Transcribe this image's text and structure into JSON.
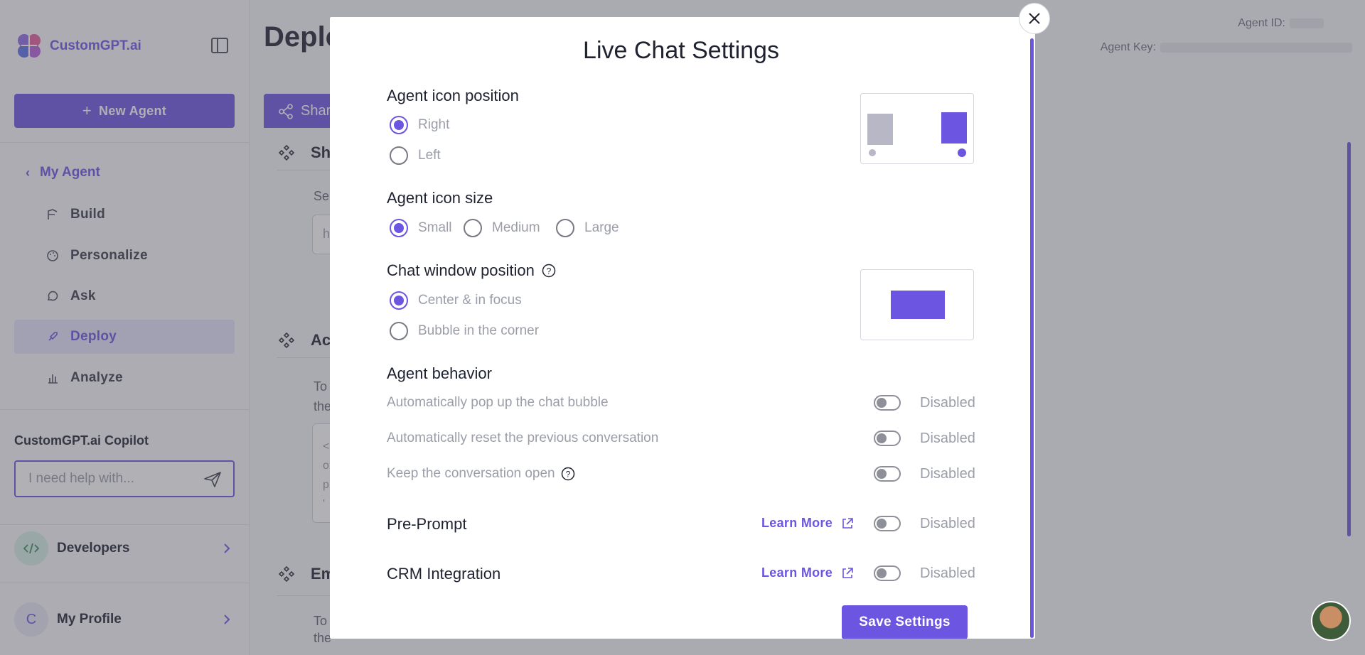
{
  "sidebar": {
    "logo_text": "CustomGPT.ai",
    "new_agent_label": "New Agent",
    "back_label": "My Agent",
    "nav": [
      {
        "label": "Build",
        "icon": "build-icon"
      },
      {
        "label": "Personalize",
        "icon": "palette-icon"
      },
      {
        "label": "Ask",
        "icon": "chat-icon"
      },
      {
        "label": "Deploy",
        "icon": "rocket-icon",
        "active": true
      },
      {
        "label": "Analyze",
        "icon": "bar-chart-icon"
      }
    ],
    "copilot": {
      "title": "CustomGPT.ai Copilot",
      "placeholder": "I need help with..."
    },
    "developers_label": "Developers",
    "profile_label": "My Profile",
    "profile_initial": "C"
  },
  "main": {
    "title": "Deplo",
    "tab_label": "Shar",
    "agent_id_label": "Agent ID:",
    "agent_key_label": "Agent Key:",
    "sections": [
      {
        "heading": "Sh",
        "text": [
          "Ser"
        ]
      },
      {
        "heading": "Ac",
        "text": [
          "To",
          "the"
        ]
      },
      {
        "heading": "Em",
        "text": [
          "To",
          "the "
        ]
      }
    ],
    "box1_text": "h",
    "box2_text": [
      "<",
      "o",
      "p",
      "'"
    ]
  },
  "modal": {
    "title": "Live Chat Settings",
    "icon_position": {
      "label": "Agent icon position",
      "options": [
        "Right",
        "Left"
      ],
      "selected": "Right"
    },
    "icon_size": {
      "label": "Agent icon size",
      "options": [
        "Small",
        "Medium",
        "Large"
      ],
      "selected": "Small"
    },
    "window_position": {
      "label": "Chat window position",
      "options": [
        "Center & in focus",
        "Bubble in the corner"
      ],
      "selected": "Center & in focus"
    },
    "behavior": {
      "label": "Agent behavior",
      "rows": [
        {
          "label": "Automatically pop up the chat bubble",
          "status": "Disabled",
          "help": false
        },
        {
          "label": "Automatically reset the previous conversation",
          "status": "Disabled",
          "help": false
        },
        {
          "label": "Keep the conversation open",
          "status": "Disabled",
          "help": true
        }
      ]
    },
    "pre_prompt": {
      "label": "Pre-Prompt",
      "link": "Learn More",
      "status": "Disabled"
    },
    "crm": {
      "label": "CRM Integration",
      "link": "Learn More",
      "status": "Disabled"
    },
    "save_label": "Save Settings"
  },
  "colors": {
    "accent": "#6c55e0",
    "preview_gray": "#b8b7c5"
  }
}
